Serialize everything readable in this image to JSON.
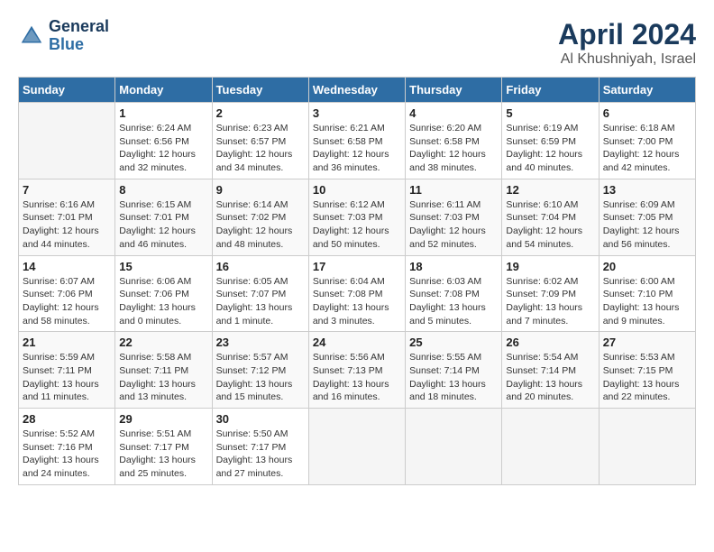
{
  "header": {
    "logo_line1": "General",
    "logo_line2": "Blue",
    "title": "April 2024",
    "subtitle": "Al Khushniyah, Israel"
  },
  "days_of_week": [
    "Sunday",
    "Monday",
    "Tuesday",
    "Wednesday",
    "Thursday",
    "Friday",
    "Saturday"
  ],
  "weeks": [
    [
      {
        "day": "",
        "info": ""
      },
      {
        "day": "1",
        "info": "Sunrise: 6:24 AM\nSunset: 6:56 PM\nDaylight: 12 hours\nand 32 minutes."
      },
      {
        "day": "2",
        "info": "Sunrise: 6:23 AM\nSunset: 6:57 PM\nDaylight: 12 hours\nand 34 minutes."
      },
      {
        "day": "3",
        "info": "Sunrise: 6:21 AM\nSunset: 6:58 PM\nDaylight: 12 hours\nand 36 minutes."
      },
      {
        "day": "4",
        "info": "Sunrise: 6:20 AM\nSunset: 6:58 PM\nDaylight: 12 hours\nand 38 minutes."
      },
      {
        "day": "5",
        "info": "Sunrise: 6:19 AM\nSunset: 6:59 PM\nDaylight: 12 hours\nand 40 minutes."
      },
      {
        "day": "6",
        "info": "Sunrise: 6:18 AM\nSunset: 7:00 PM\nDaylight: 12 hours\nand 42 minutes."
      }
    ],
    [
      {
        "day": "7",
        "info": "Sunrise: 6:16 AM\nSunset: 7:01 PM\nDaylight: 12 hours\nand 44 minutes."
      },
      {
        "day": "8",
        "info": "Sunrise: 6:15 AM\nSunset: 7:01 PM\nDaylight: 12 hours\nand 46 minutes."
      },
      {
        "day": "9",
        "info": "Sunrise: 6:14 AM\nSunset: 7:02 PM\nDaylight: 12 hours\nand 48 minutes."
      },
      {
        "day": "10",
        "info": "Sunrise: 6:12 AM\nSunset: 7:03 PM\nDaylight: 12 hours\nand 50 minutes."
      },
      {
        "day": "11",
        "info": "Sunrise: 6:11 AM\nSunset: 7:03 PM\nDaylight: 12 hours\nand 52 minutes."
      },
      {
        "day": "12",
        "info": "Sunrise: 6:10 AM\nSunset: 7:04 PM\nDaylight: 12 hours\nand 54 minutes."
      },
      {
        "day": "13",
        "info": "Sunrise: 6:09 AM\nSunset: 7:05 PM\nDaylight: 12 hours\nand 56 minutes."
      }
    ],
    [
      {
        "day": "14",
        "info": "Sunrise: 6:07 AM\nSunset: 7:06 PM\nDaylight: 12 hours\nand 58 minutes."
      },
      {
        "day": "15",
        "info": "Sunrise: 6:06 AM\nSunset: 7:06 PM\nDaylight: 13 hours\nand 0 minutes."
      },
      {
        "day": "16",
        "info": "Sunrise: 6:05 AM\nSunset: 7:07 PM\nDaylight: 13 hours\nand 1 minute."
      },
      {
        "day": "17",
        "info": "Sunrise: 6:04 AM\nSunset: 7:08 PM\nDaylight: 13 hours\nand 3 minutes."
      },
      {
        "day": "18",
        "info": "Sunrise: 6:03 AM\nSunset: 7:08 PM\nDaylight: 13 hours\nand 5 minutes."
      },
      {
        "day": "19",
        "info": "Sunrise: 6:02 AM\nSunset: 7:09 PM\nDaylight: 13 hours\nand 7 minutes."
      },
      {
        "day": "20",
        "info": "Sunrise: 6:00 AM\nSunset: 7:10 PM\nDaylight: 13 hours\nand 9 minutes."
      }
    ],
    [
      {
        "day": "21",
        "info": "Sunrise: 5:59 AM\nSunset: 7:11 PM\nDaylight: 13 hours\nand 11 minutes."
      },
      {
        "day": "22",
        "info": "Sunrise: 5:58 AM\nSunset: 7:11 PM\nDaylight: 13 hours\nand 13 minutes."
      },
      {
        "day": "23",
        "info": "Sunrise: 5:57 AM\nSunset: 7:12 PM\nDaylight: 13 hours\nand 15 minutes."
      },
      {
        "day": "24",
        "info": "Sunrise: 5:56 AM\nSunset: 7:13 PM\nDaylight: 13 hours\nand 16 minutes."
      },
      {
        "day": "25",
        "info": "Sunrise: 5:55 AM\nSunset: 7:14 PM\nDaylight: 13 hours\nand 18 minutes."
      },
      {
        "day": "26",
        "info": "Sunrise: 5:54 AM\nSunset: 7:14 PM\nDaylight: 13 hours\nand 20 minutes."
      },
      {
        "day": "27",
        "info": "Sunrise: 5:53 AM\nSunset: 7:15 PM\nDaylight: 13 hours\nand 22 minutes."
      }
    ],
    [
      {
        "day": "28",
        "info": "Sunrise: 5:52 AM\nSunset: 7:16 PM\nDaylight: 13 hours\nand 24 minutes."
      },
      {
        "day": "29",
        "info": "Sunrise: 5:51 AM\nSunset: 7:17 PM\nDaylight: 13 hours\nand 25 minutes."
      },
      {
        "day": "30",
        "info": "Sunrise: 5:50 AM\nSunset: 7:17 PM\nDaylight: 13 hours\nand 27 minutes."
      },
      {
        "day": "",
        "info": ""
      },
      {
        "day": "",
        "info": ""
      },
      {
        "day": "",
        "info": ""
      },
      {
        "day": "",
        "info": ""
      }
    ]
  ]
}
